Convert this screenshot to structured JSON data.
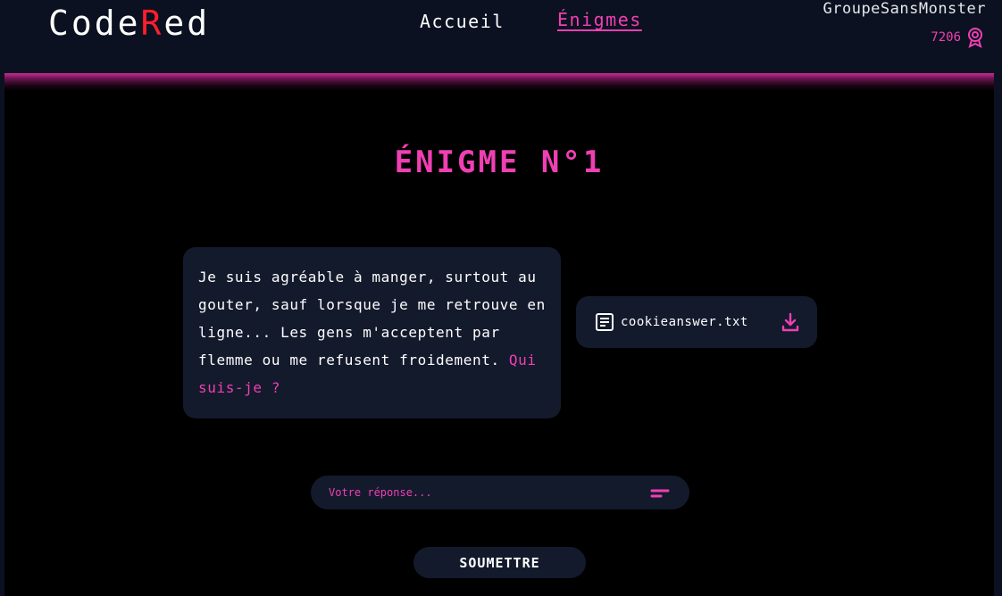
{
  "header": {
    "logo_prefix": "Code",
    "logo_accent": "R",
    "logo_suffix": "ed",
    "nav": {
      "home": "Accueil",
      "puzzles": "Énigmes"
    },
    "user": {
      "name": "GroupeSansMonster",
      "score": "7206",
      "score_icon": "award-badge-icon"
    }
  },
  "main": {
    "title": "ÉNIGME N°1",
    "riddle": {
      "text": "Je suis agréable à manger, surtout au gouter, sauf lorsque je me retrouve en ligne... Les gens m'acceptent par flemme ou me refusent froidement. ",
      "question": "Qui suis-je ?"
    },
    "file": {
      "name": "cookieanswer.txt",
      "icon": "text-file-icon",
      "action_icon": "download-icon"
    },
    "answer": {
      "value": "",
      "placeholder": "Votre réponse...",
      "icon": "lines-icon"
    },
    "submit_label": "SOUMETTRE"
  },
  "colors": {
    "accent": "#f03fb3",
    "logo_red": "#ff1e2d",
    "header_bg": "#0b1120",
    "card_bg": "#131a2c",
    "page_bg": "#000000"
  }
}
